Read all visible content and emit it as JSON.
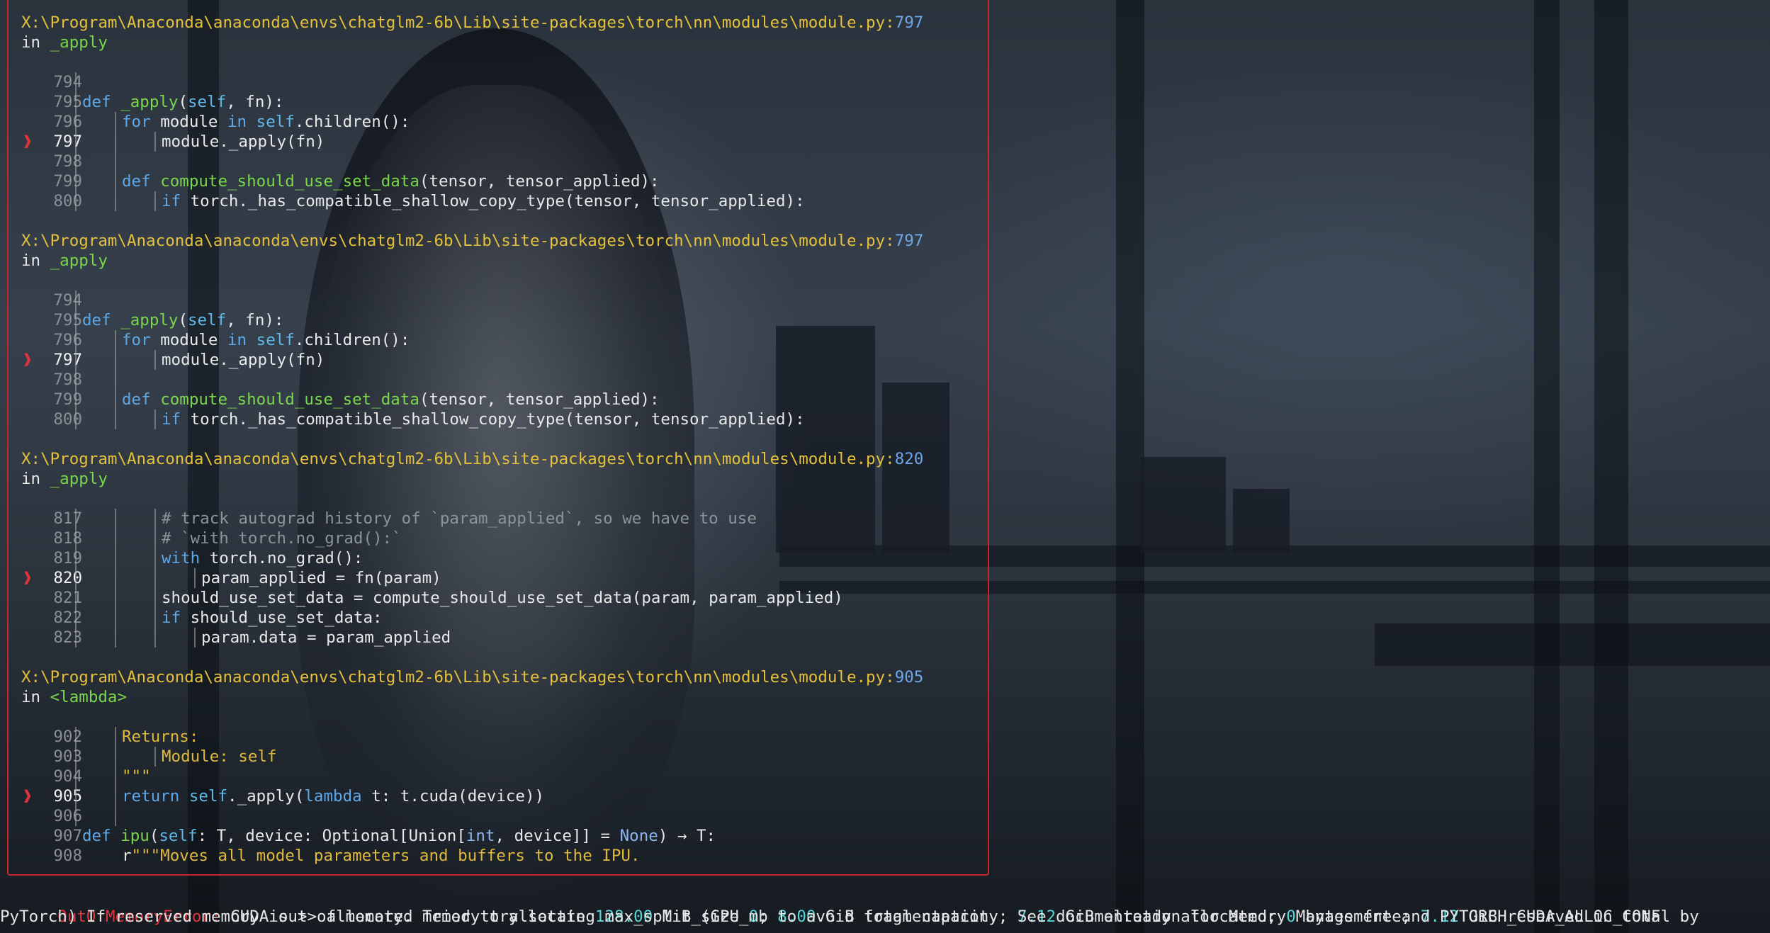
{
  "frames": [
    {
      "path": "X:\\Program\\Anaconda\\anaconda\\envs\\chatglm2-6b\\Lib\\site-packages\\torch\\nn\\modules\\module.py",
      "line_no": "797",
      "in_word": "in",
      "func": "_apply",
      "code": [
        {
          "num": "794",
          "text": ""
        },
        {
          "num": "795",
          "text": "def _apply(self, fn):"
        },
        {
          "num": "796",
          "text": "for module in self.children():"
        },
        {
          "num": "797",
          "text": "module._apply(fn)"
        },
        {
          "num": "798",
          "text": ""
        },
        {
          "num": "799",
          "text": "def compute_should_use_set_data(tensor, tensor_applied):"
        },
        {
          "num": "800",
          "text": "if torch._has_compatible_shallow_copy_type(tensor, tensor_applied):"
        }
      ]
    },
    {
      "path": "X:\\Program\\Anaconda\\anaconda\\envs\\chatglm2-6b\\Lib\\site-packages\\torch\\nn\\modules\\module.py",
      "line_no": "797",
      "in_word": "in",
      "func": "_apply",
      "code": [
        {
          "num": "794",
          "text": ""
        },
        {
          "num": "795",
          "text": "def _apply(self, fn):"
        },
        {
          "num": "796",
          "text": "for module in self.children():"
        },
        {
          "num": "797",
          "text": "module._apply(fn)"
        },
        {
          "num": "798",
          "text": ""
        },
        {
          "num": "799",
          "text": "def compute_should_use_set_data(tensor, tensor_applied):"
        },
        {
          "num": "800",
          "text": "if torch._has_compatible_shallow_copy_type(tensor, tensor_applied):"
        }
      ]
    },
    {
      "path": "X:\\Program\\Anaconda\\anaconda\\envs\\chatglm2-6b\\Lib\\site-packages\\torch\\nn\\modules\\module.py",
      "line_no": "820",
      "in_word": "in",
      "func": "_apply",
      "code": [
        {
          "num": "817",
          "text": "# track autograd history of `param_applied`, so we have to use"
        },
        {
          "num": "818",
          "text": "# `with torch.no_grad():`"
        },
        {
          "num": "819",
          "text": "with torch.no_grad():"
        },
        {
          "num": "820",
          "text": "param_applied = fn(param)"
        },
        {
          "num": "821",
          "text": "should_use_set_data = compute_should_use_set_data(param, param_applied)"
        },
        {
          "num": "822",
          "text": "if should_use_set_data:"
        },
        {
          "num": "823",
          "text": "param.data = param_applied"
        }
      ]
    },
    {
      "path": "X:\\Program\\Anaconda\\anaconda\\envs\\chatglm2-6b\\Lib\\site-packages\\torch\\nn\\modules\\module.py",
      "line_no": "905",
      "in_word": "in",
      "func": "<lambda>",
      "code": [
        {
          "num": "902",
          "text": "Returns:"
        },
        {
          "num": "903",
          "text": "Module: self"
        },
        {
          "num": "904",
          "text": "\"\"\""
        },
        {
          "num": "905",
          "text": "return self._apply(lambda t: t.cuda(device))"
        },
        {
          "num": "906",
          "text": ""
        },
        {
          "num": "907",
          "text": "def ipu(self: T, device: Optional[Union[int, device]] = None) → T:"
        },
        {
          "num": "908",
          "text": "r\"\"\"Moves all model parameters and buffers to the IPU."
        }
      ]
    }
  ],
  "marker_glyph": "❱",
  "error": {
    "name": "OutOfMemoryError:",
    "line1_parts": [
      {
        "t": "CUDA out of memory. Tried to allocate ",
        "k": "plain"
      },
      {
        "t": "128.00",
        "k": "num"
      },
      {
        "t": " MiB (GPU ",
        "k": "plain"
      },
      {
        "t": "0",
        "k": "num"
      },
      {
        "t": "; ",
        "k": "plain"
      },
      {
        "t": "8.00",
        "k": "num"
      },
      {
        "t": " GiB total capacity; ",
        "k": "plain"
      },
      {
        "t": "7.12",
        "k": "num"
      },
      {
        "t": " GiB already allocated; ",
        "k": "plain"
      },
      {
        "t": "0",
        "k": "num"
      },
      {
        "t": " bytes free; ",
        "k": "plain"
      },
      {
        "t": "7.12",
        "k": "num"
      },
      {
        "t": " GiB reserved in total by",
        "k": "plain"
      }
    ],
    "line2": "PyTorch) If reserved memory is >> allocated memory try setting max_split_size_mb to avoid fragmentation.  See documentation for Memory Management and PYTORCH_CUDA_ALLOC_CONF"
  },
  "colors": {
    "frame_border": "#c8262c",
    "path": "#e5c13a",
    "func": "#7ad64a",
    "keyword": "#5fa8e8",
    "error_name": "#e0343c",
    "error_number": "#56d6d6"
  }
}
